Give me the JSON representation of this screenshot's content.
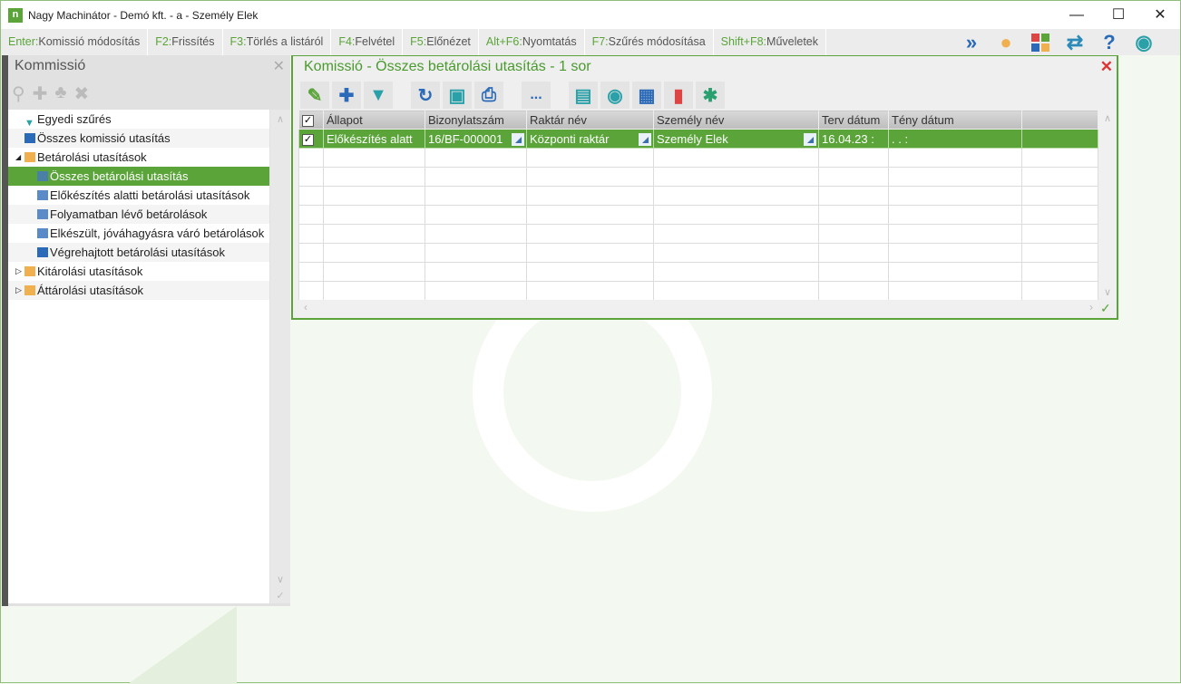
{
  "window": {
    "title": "Nagy Machinátor - Demó kft. - a - Személy Elek",
    "logo": "n"
  },
  "shortcuts": [
    {
      "key": "Enter:",
      "label": "Komissió módosítás"
    },
    {
      "key": "F2:",
      "label": "Frissítés"
    },
    {
      "key": "F3:",
      "label": "Törlés a listáról"
    },
    {
      "key": "F4:",
      "label": "Felvétel"
    },
    {
      "key": "F5:",
      "label": "Előnézet"
    },
    {
      "key": "Alt+F6:",
      "label": "Nyomtatás"
    },
    {
      "key": "F7:",
      "label": "Szűrés módosítása"
    },
    {
      "key": "Shift+F8:",
      "label": "Műveletek"
    }
  ],
  "left_panel": {
    "title": "Kommissió",
    "tree": [
      {
        "label": "Egyedi szűrés"
      },
      {
        "label": "Összes komissió utasítás"
      },
      {
        "label": "Betárolási utasítások"
      },
      {
        "label": "Összes betárolási utasítás"
      },
      {
        "label": "Előkészítés alatti betárolási utasítások"
      },
      {
        "label": "Folyamatban lévő betárolások"
      },
      {
        "label": "Elkészült, jóváhagyásra váró betárolások"
      },
      {
        "label": "Végrehajtott betárolási utasítások"
      },
      {
        "label": "Kitárolási utasítások"
      },
      {
        "label": "Áttárolási utasítások"
      }
    ]
  },
  "main": {
    "title": "Komissió - Összes betárolási utasítás - 1 sor",
    "more_label": "...",
    "columns": [
      "Állapot",
      "Bizonylatszám",
      "Raktár név",
      "Személy név",
      "Terv dátum",
      "Tény dátum"
    ],
    "rows": [
      [
        "Előkészítés alatt",
        "16/BF-000001",
        "Központi raktár",
        "Személy Elek",
        "16.04.23   :",
        ".  .     :"
      ]
    ]
  },
  "colors": {
    "accent": "#5aa43a"
  }
}
